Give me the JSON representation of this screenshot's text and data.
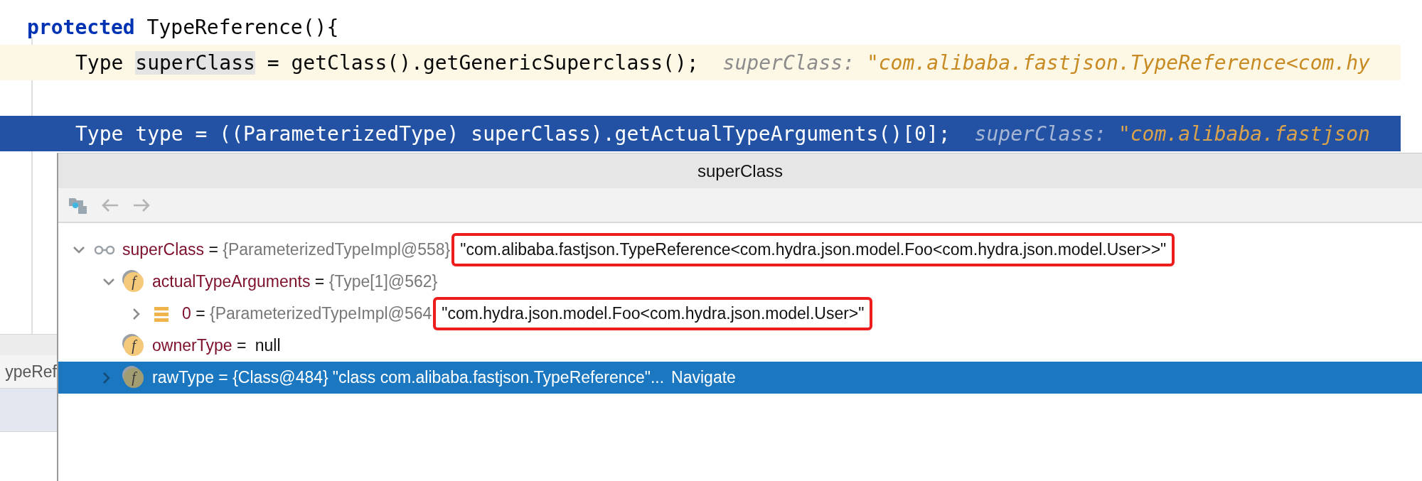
{
  "editor": {
    "lines": [
      {
        "kind": "signature",
        "current": false,
        "selected": false,
        "gap_before": false,
        "segments": [
          {
            "kind": "keyword",
            "text": "protected"
          },
          {
            "kind": "plain",
            "text": " TypeReference(){"
          }
        ]
      },
      {
        "kind": "body",
        "current": true,
        "selected": false,
        "gap_before": false,
        "segments": [
          {
            "kind": "plain",
            "text": "Type "
          },
          {
            "kind": "usage",
            "text": "superClass"
          },
          {
            "kind": "plain",
            "text": " = getClass().getGenericSuperclass();"
          }
        ],
        "hint": {
          "label": "superClass:",
          "value": "\"com.alibaba.fastjson.TypeReference<com.hy"
        }
      },
      {
        "kind": "body",
        "current": false,
        "selected": true,
        "gap_before": true,
        "segments": [
          {
            "kind": "plain",
            "text": "Type type = ((ParameterizedType) superClass).getActualTypeArguments()[0];"
          }
        ],
        "hint": {
          "label": "superClass:",
          "value": "\"com.alibaba.fastjson"
        }
      }
    ]
  },
  "bottom_panel": {
    "tab": "ypeRef"
  },
  "popup": {
    "title": "superClass",
    "toolbar": [
      {
        "kind": "frame"
      },
      {
        "kind": "back",
        "disabled": true
      },
      {
        "kind": "forward",
        "disabled": true
      }
    ],
    "tree": [
      {
        "kind": "watch",
        "name": "superClass",
        "operator": "=",
        "type_ref": "{ParameterizedTypeImpl@558}",
        "value": "\"com.alibaba.fastjson.TypeReference<com.hydra.json.model.Foo<com.hydra.json.model.User>>\"",
        "expanded": true,
        "selected": false,
        "boxed": true,
        "children": [
          {
            "kind": "field",
            "badge": "f",
            "name": "actualTypeArguments",
            "operator": "=",
            "type_ref": "{Type[1]@562}",
            "expanded": true,
            "selected": false,
            "children": [
              {
                "kind": "element",
                "name": "0",
                "operator": "=",
                "type_ref": "{ParameterizedTypeImpl@564",
                "value": "\"com.hydra.json.model.Foo<com.hydra.json.model.User>\"",
                "expanded": false,
                "selected": false,
                "boxed": true
              }
            ]
          },
          {
            "kind": "field",
            "badge": "f",
            "name": "ownerType",
            "operator": "=",
            "value": "null",
            "selected": false,
            "boxed": false
          },
          {
            "kind": "field",
            "badge": "f",
            "name": "rawType",
            "operator": "=",
            "type_ref": "{Class@484}",
            "value": "\"class com.alibaba.fastjson.TypeReference\"...",
            "link": "Navigate",
            "expanded": false,
            "selected": true,
            "boxed": false
          }
        ]
      }
    ]
  }
}
